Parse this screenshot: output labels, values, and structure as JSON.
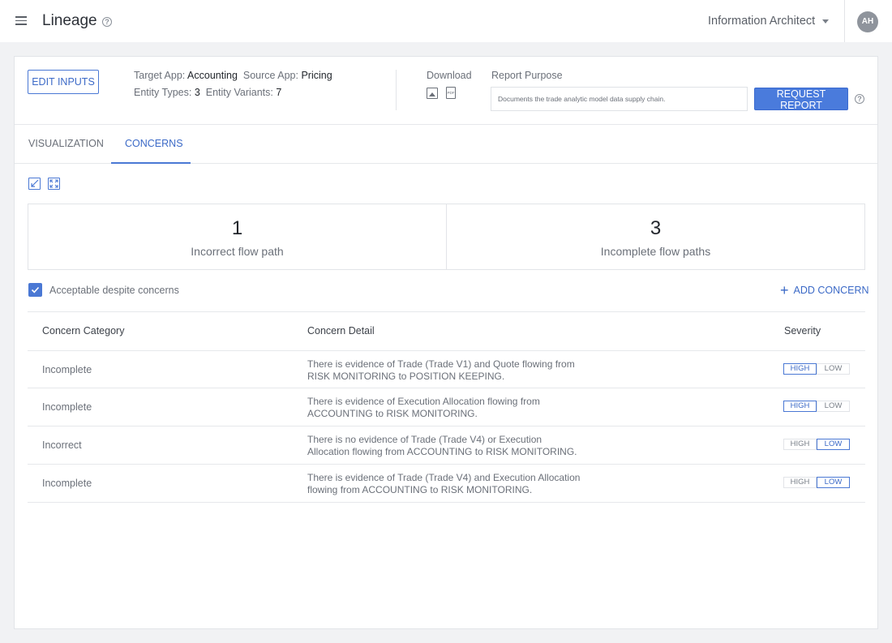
{
  "topbar": {
    "title": "Lineage",
    "help": "?",
    "role": "Information Architect",
    "avatar": "AH"
  },
  "header": {
    "edit_label": "EDIT INPUTS",
    "target_label": "Target App:",
    "target_value": "Accounting",
    "source_label": "Source App:",
    "source_value": "Pricing",
    "entity_types_label": "Entity Types:",
    "entity_types_value": "3",
    "entity_variants_label": "Entity Variants:",
    "entity_variants_value": "7",
    "download_label": "Download",
    "pdf_label": "PDF",
    "report_purpose_label": "Report Purpose",
    "report_purpose_value": "Documents the trade analytic model data supply chain.",
    "request_label": "REQUEST REPORT"
  },
  "tabs": [
    {
      "label": "VISUALIZATION"
    },
    {
      "label": "CONCERNS"
    }
  ],
  "stats": [
    {
      "value": "1",
      "label": "Incorrect flow path"
    },
    {
      "value": "3",
      "label": "Incomplete flow paths"
    }
  ],
  "acceptable_label": "Acceptable despite concerns",
  "add_concern_label": "ADD CONCERN",
  "table": {
    "headers": [
      "Concern Category",
      "Concern Detail",
      "Severity"
    ],
    "rows": [
      {
        "category": "Incomplete",
        "detail_1": "There is evidence of Trade (Trade V1) and Quote flowing from",
        "detail_2": "RISK MONITORING to POSITION KEEPING.",
        "high": "HIGH",
        "low": "LOW"
      },
      {
        "category": "Incomplete",
        "detail_1": "There is evidence of Execution Allocation flowing from",
        "detail_2": "ACCOUNTING to RISK MONITORING.",
        "high": "HIGH",
        "low": "LOW"
      },
      {
        "category": "Incorrect",
        "detail_1": "There is no evidence of Trade (Trade V4) or Execution",
        "detail_2": "Allocation flowing from ACCOUNTING to RISK MONITORING.",
        "high": "HIGH",
        "low": "LOW"
      },
      {
        "category": "Incomplete",
        "detail_1": "There is evidence of Trade (Trade V4) and Execution Allocation",
        "detail_2": "flowing from ACCOUNTING to RISK MONITORING.",
        "high": "HIGH",
        "low": "LOW"
      }
    ]
  },
  "colors": {
    "accent": "#4a78d4",
    "background": "#f1f2f4"
  }
}
